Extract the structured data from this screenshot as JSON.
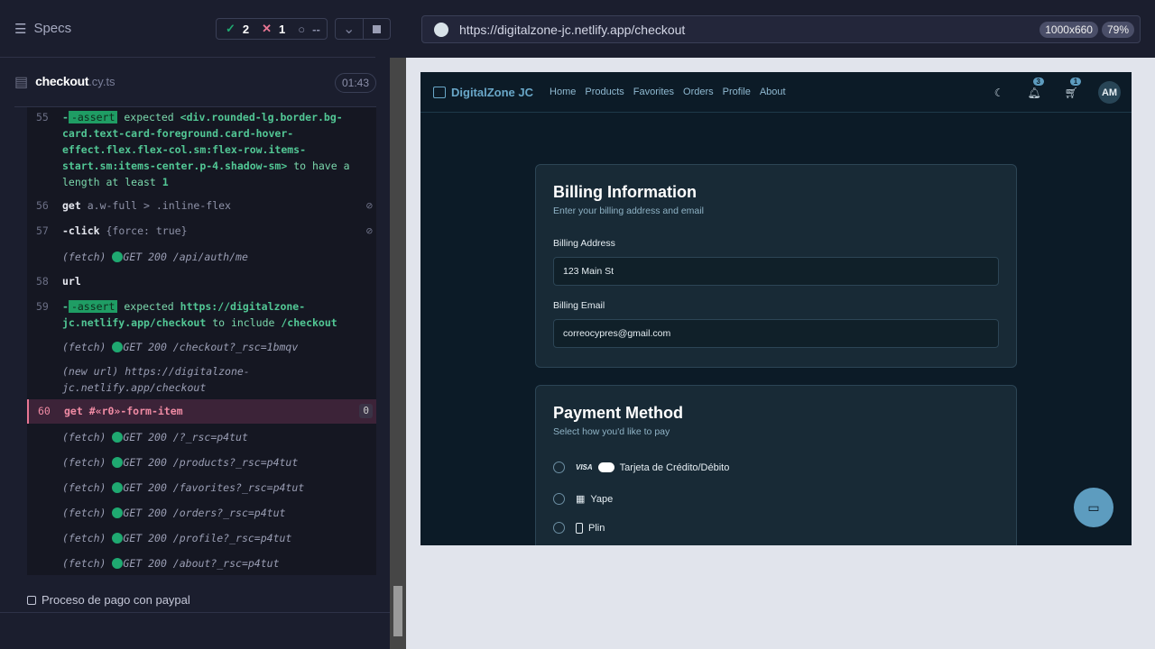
{
  "reporter": {
    "specs_label": "Specs",
    "passed": "2",
    "failed": "1",
    "pending": "--",
    "file_name": "checkout",
    "file_ext": ".cy.ts",
    "duration": "01:43",
    "commands": [
      {
        "num": "55",
        "name": "-assert",
        "msg1": "expected",
        "subject": "<div.rounded-lg.border.bg-card.text-card-foreground.card-hover-effect.flex.flex-col.sm:flex-row.items-start.sm:items-center.p-4.shadow-sm>",
        "msg2": "to have a length at least",
        "value": "1"
      },
      {
        "num": "56",
        "name": "get",
        "msg": "a.w-full > .inline-flex"
      },
      {
        "num": "57",
        "name": "-click",
        "msg": "{force: true}"
      },
      {
        "num": "",
        "name": "(fetch)",
        "msg": "GET 200 /api/auth/me"
      },
      {
        "num": "58",
        "name": "url",
        "msg": ""
      },
      {
        "num": "59",
        "name": "-assert",
        "msg1": "expected",
        "subject": "https://digitalzone-jc.netlify.app/checkout",
        "msg2": "to include",
        "value": "/checkout"
      },
      {
        "num": "",
        "name": "(fetch)",
        "msg": "GET 200 /checkout?_rsc=1bmqv"
      },
      {
        "num": "",
        "name": "(new url)",
        "msg": "https://digitalzone-jc.netlify.app/checkout"
      },
      {
        "num": "60",
        "name": "get",
        "msg": "#«r0»-form-item",
        "count": "0"
      },
      {
        "num": "",
        "name": "(fetch)",
        "msg": "GET 200 /?_rsc=p4tut"
      },
      {
        "num": "",
        "name": "(fetch)",
        "msg": "GET 200 /products?_rsc=p4tut"
      },
      {
        "num": "",
        "name": "(fetch)",
        "msg": "GET 200 /favorites?_rsc=p4tut"
      },
      {
        "num": "",
        "name": "(fetch)",
        "msg": "GET 200 /orders?_rsc=p4tut"
      },
      {
        "num": "",
        "name": "(fetch)",
        "msg": "GET 200 /profile?_rsc=p4tut"
      },
      {
        "num": "",
        "name": "(fetch)",
        "msg": "GET 200 /about?_rsc=p4tut"
      }
    ],
    "test_title": "Proceso de pago con paypal"
  },
  "browser": {
    "url": "https://digitalzone-jc.netlify.app/checkout",
    "viewport": "1000x660",
    "zoom": "79%"
  },
  "app": {
    "brand": "DigitalZone JC",
    "nav": [
      "Home",
      "Products",
      "Favorites",
      "Orders",
      "Profile",
      "About"
    ],
    "notifications": "3",
    "cart": "1",
    "avatar": "AM",
    "billing": {
      "title": "Billing Information",
      "subtitle": "Enter your billing address and email",
      "address_label": "Billing Address",
      "address_value": "123 Main St",
      "email_label": "Billing Email",
      "email_value": "correocypres@gmail.com"
    },
    "payment": {
      "title": "Payment Method",
      "subtitle": "Select how you'd like to pay",
      "visa": "VISA",
      "options": [
        "Tarjeta de Crédito/Débito",
        "Yape",
        "Plin"
      ]
    }
  },
  "colors": {
    "accent": "#5d9cbf",
    "pass": "#1fa971",
    "fail": "#e87693"
  }
}
